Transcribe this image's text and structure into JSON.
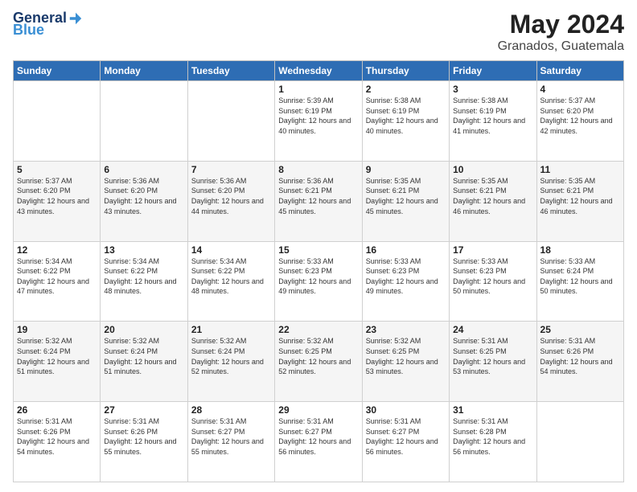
{
  "logo": {
    "general": "General",
    "blue": "Blue"
  },
  "title": {
    "month": "May 2024",
    "location": "Granados, Guatemala"
  },
  "weekdays": [
    "Sunday",
    "Monday",
    "Tuesday",
    "Wednesday",
    "Thursday",
    "Friday",
    "Saturday"
  ],
  "weeks": [
    [
      {
        "day": "",
        "sunrise": "",
        "sunset": "",
        "daylight": ""
      },
      {
        "day": "",
        "sunrise": "",
        "sunset": "",
        "daylight": ""
      },
      {
        "day": "",
        "sunrise": "",
        "sunset": "",
        "daylight": ""
      },
      {
        "day": "1",
        "sunrise": "Sunrise: 5:39 AM",
        "sunset": "Sunset: 6:19 PM",
        "daylight": "Daylight: 12 hours and 40 minutes."
      },
      {
        "day": "2",
        "sunrise": "Sunrise: 5:38 AM",
        "sunset": "Sunset: 6:19 PM",
        "daylight": "Daylight: 12 hours and 40 minutes."
      },
      {
        "day": "3",
        "sunrise": "Sunrise: 5:38 AM",
        "sunset": "Sunset: 6:19 PM",
        "daylight": "Daylight: 12 hours and 41 minutes."
      },
      {
        "day": "4",
        "sunrise": "Sunrise: 5:37 AM",
        "sunset": "Sunset: 6:20 PM",
        "daylight": "Daylight: 12 hours and 42 minutes."
      }
    ],
    [
      {
        "day": "5",
        "sunrise": "Sunrise: 5:37 AM",
        "sunset": "Sunset: 6:20 PM",
        "daylight": "Daylight: 12 hours and 43 minutes."
      },
      {
        "day": "6",
        "sunrise": "Sunrise: 5:36 AM",
        "sunset": "Sunset: 6:20 PM",
        "daylight": "Daylight: 12 hours and 43 minutes."
      },
      {
        "day": "7",
        "sunrise": "Sunrise: 5:36 AM",
        "sunset": "Sunset: 6:20 PM",
        "daylight": "Daylight: 12 hours and 44 minutes."
      },
      {
        "day": "8",
        "sunrise": "Sunrise: 5:36 AM",
        "sunset": "Sunset: 6:21 PM",
        "daylight": "Daylight: 12 hours and 45 minutes."
      },
      {
        "day": "9",
        "sunrise": "Sunrise: 5:35 AM",
        "sunset": "Sunset: 6:21 PM",
        "daylight": "Daylight: 12 hours and 45 minutes."
      },
      {
        "day": "10",
        "sunrise": "Sunrise: 5:35 AM",
        "sunset": "Sunset: 6:21 PM",
        "daylight": "Daylight: 12 hours and 46 minutes."
      },
      {
        "day": "11",
        "sunrise": "Sunrise: 5:35 AM",
        "sunset": "Sunset: 6:21 PM",
        "daylight": "Daylight: 12 hours and 46 minutes."
      }
    ],
    [
      {
        "day": "12",
        "sunrise": "Sunrise: 5:34 AM",
        "sunset": "Sunset: 6:22 PM",
        "daylight": "Daylight: 12 hours and 47 minutes."
      },
      {
        "day": "13",
        "sunrise": "Sunrise: 5:34 AM",
        "sunset": "Sunset: 6:22 PM",
        "daylight": "Daylight: 12 hours and 48 minutes."
      },
      {
        "day": "14",
        "sunrise": "Sunrise: 5:34 AM",
        "sunset": "Sunset: 6:22 PM",
        "daylight": "Daylight: 12 hours and 48 minutes."
      },
      {
        "day": "15",
        "sunrise": "Sunrise: 5:33 AM",
        "sunset": "Sunset: 6:23 PM",
        "daylight": "Daylight: 12 hours and 49 minutes."
      },
      {
        "day": "16",
        "sunrise": "Sunrise: 5:33 AM",
        "sunset": "Sunset: 6:23 PM",
        "daylight": "Daylight: 12 hours and 49 minutes."
      },
      {
        "day": "17",
        "sunrise": "Sunrise: 5:33 AM",
        "sunset": "Sunset: 6:23 PM",
        "daylight": "Daylight: 12 hours and 50 minutes."
      },
      {
        "day": "18",
        "sunrise": "Sunrise: 5:33 AM",
        "sunset": "Sunset: 6:24 PM",
        "daylight": "Daylight: 12 hours and 50 minutes."
      }
    ],
    [
      {
        "day": "19",
        "sunrise": "Sunrise: 5:32 AM",
        "sunset": "Sunset: 6:24 PM",
        "daylight": "Daylight: 12 hours and 51 minutes."
      },
      {
        "day": "20",
        "sunrise": "Sunrise: 5:32 AM",
        "sunset": "Sunset: 6:24 PM",
        "daylight": "Daylight: 12 hours and 51 minutes."
      },
      {
        "day": "21",
        "sunrise": "Sunrise: 5:32 AM",
        "sunset": "Sunset: 6:24 PM",
        "daylight": "Daylight: 12 hours and 52 minutes."
      },
      {
        "day": "22",
        "sunrise": "Sunrise: 5:32 AM",
        "sunset": "Sunset: 6:25 PM",
        "daylight": "Daylight: 12 hours and 52 minutes."
      },
      {
        "day": "23",
        "sunrise": "Sunrise: 5:32 AM",
        "sunset": "Sunset: 6:25 PM",
        "daylight": "Daylight: 12 hours and 53 minutes."
      },
      {
        "day": "24",
        "sunrise": "Sunrise: 5:31 AM",
        "sunset": "Sunset: 6:25 PM",
        "daylight": "Daylight: 12 hours and 53 minutes."
      },
      {
        "day": "25",
        "sunrise": "Sunrise: 5:31 AM",
        "sunset": "Sunset: 6:26 PM",
        "daylight": "Daylight: 12 hours and 54 minutes."
      }
    ],
    [
      {
        "day": "26",
        "sunrise": "Sunrise: 5:31 AM",
        "sunset": "Sunset: 6:26 PM",
        "daylight": "Daylight: 12 hours and 54 minutes."
      },
      {
        "day": "27",
        "sunrise": "Sunrise: 5:31 AM",
        "sunset": "Sunset: 6:26 PM",
        "daylight": "Daylight: 12 hours and 55 minutes."
      },
      {
        "day": "28",
        "sunrise": "Sunrise: 5:31 AM",
        "sunset": "Sunset: 6:27 PM",
        "daylight": "Daylight: 12 hours and 55 minutes."
      },
      {
        "day": "29",
        "sunrise": "Sunrise: 5:31 AM",
        "sunset": "Sunset: 6:27 PM",
        "daylight": "Daylight: 12 hours and 56 minutes."
      },
      {
        "day": "30",
        "sunrise": "Sunrise: 5:31 AM",
        "sunset": "Sunset: 6:27 PM",
        "daylight": "Daylight: 12 hours and 56 minutes."
      },
      {
        "day": "31",
        "sunrise": "Sunrise: 5:31 AM",
        "sunset": "Sunset: 6:28 PM",
        "daylight": "Daylight: 12 hours and 56 minutes."
      },
      {
        "day": "",
        "sunrise": "",
        "sunset": "",
        "daylight": ""
      }
    ]
  ]
}
